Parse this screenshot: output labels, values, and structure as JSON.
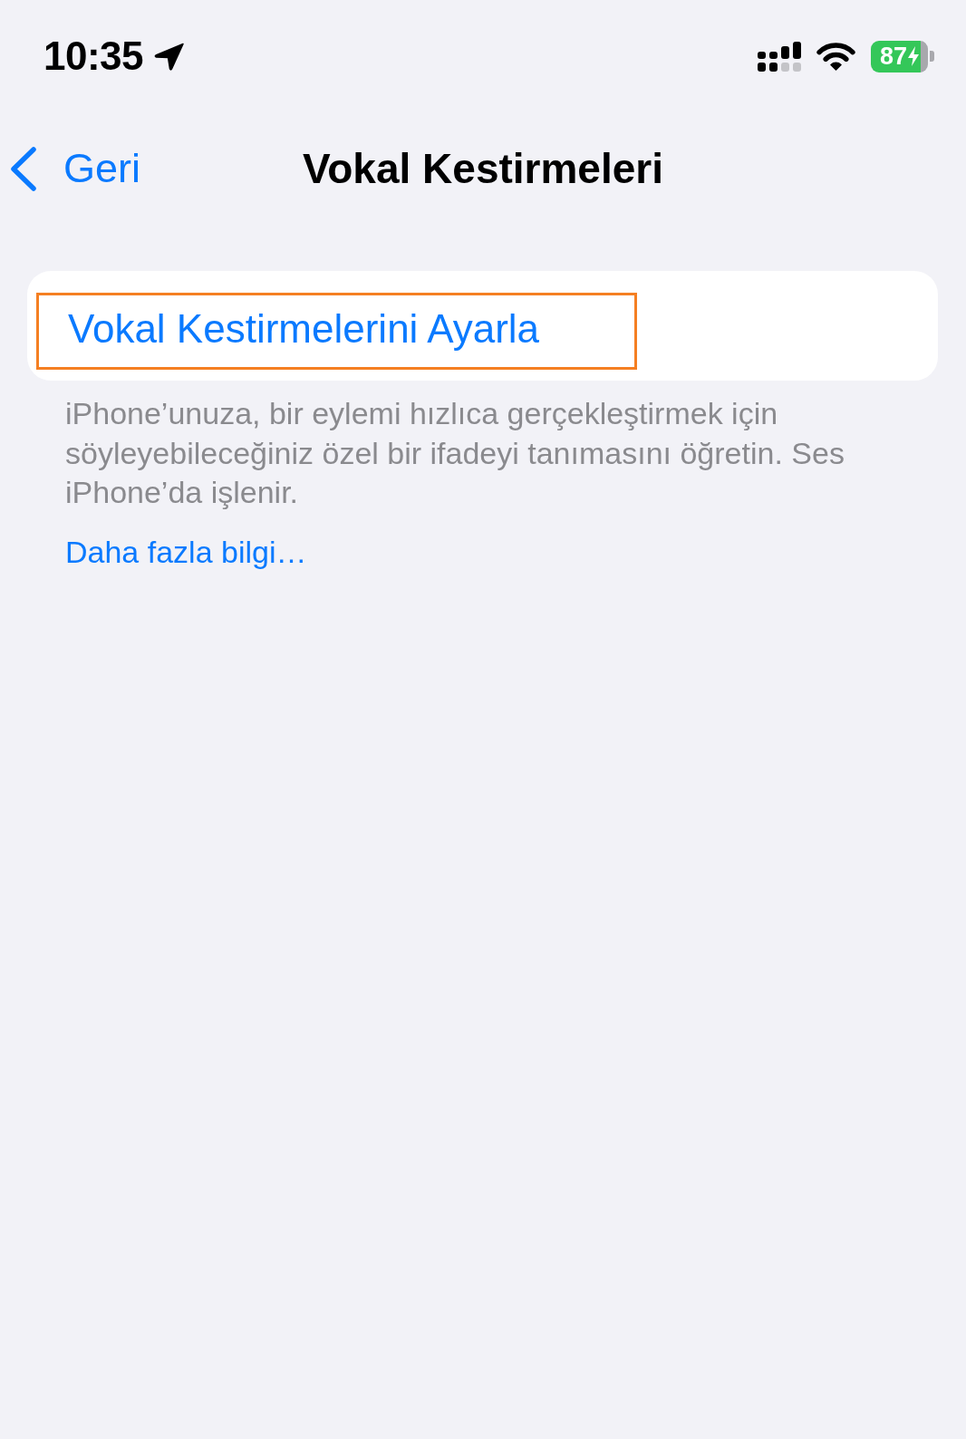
{
  "status_bar": {
    "time": "10:35",
    "location_active": true,
    "battery_text": "87",
    "charging": true
  },
  "nav_bar": {
    "back_label": "Geri",
    "title": "Vokal Kestirmeleri"
  },
  "card": {
    "items": [
      {
        "label": "Vokal Kestirmelerini Ayarla",
        "highlighted": true
      }
    ]
  },
  "footer": {
    "text": "iPhone’unuza, bir eylemi hızlıca gerçekleştirmek için söyleyebileceğiniz özel bir ifadeyi tanımasını öğretin. Ses iPhone’da işlenir.",
    "link": "Daha fazla bilgi…"
  }
}
